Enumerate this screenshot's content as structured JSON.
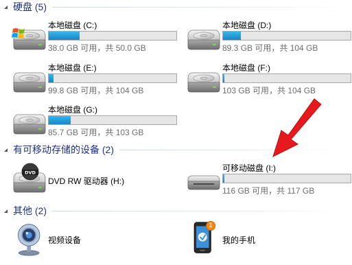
{
  "groups": {
    "hard_disks": {
      "title": "硬盘 (5)"
    },
    "removable": {
      "title": "有可移动存储的设备 (2)"
    },
    "other": {
      "title": "其他 (2)"
    }
  },
  "drives": {
    "c": {
      "name": "本地磁盘 (C:)",
      "info": "38.0 GB 可用，共 50.0 GB",
      "used_fraction": 0.24
    },
    "d": {
      "name": "本地磁盘 (D:)",
      "info": "89.3 GB 可用，共 104 GB",
      "used_fraction": 0.14
    },
    "e": {
      "name": "本地磁盘 (E:)",
      "info": "99.8 GB 可用，共 104 GB",
      "used_fraction": 0.04
    },
    "f": {
      "name": "本地磁盘 (F:)",
      "info": "103 GB 可用，共 104 GB",
      "used_fraction": 0.01
    },
    "g": {
      "name": "本地磁盘 (G:)",
      "info": "85.7 GB 可用，共 103 GB",
      "used_fraction": 0.17
    },
    "h": {
      "name": "DVD RW 驱动器 (H:)"
    },
    "i": {
      "name": "可移动磁盘 (I:)",
      "info": "116 GB 可用，共 117 GB",
      "used_fraction": 0.01
    }
  },
  "others": {
    "video": {
      "name": "视频设备"
    },
    "phone": {
      "name": "我的手机",
      "badge": "1"
    }
  },
  "icons": {
    "system_drive": "windows-drive-icon",
    "local_drive": "hard-drive-icon",
    "dvd": "dvd-drive-icon",
    "removable": "removable-drive-icon",
    "webcam": "webcam-icon",
    "phone": "phone-icon",
    "pointer": "red-arrow-icon"
  },
  "colors": {
    "header_text": "#1e3287",
    "bar_fill": "#26a0da",
    "info_text": "#6d6d6d",
    "arrow": "#e8191c"
  }
}
